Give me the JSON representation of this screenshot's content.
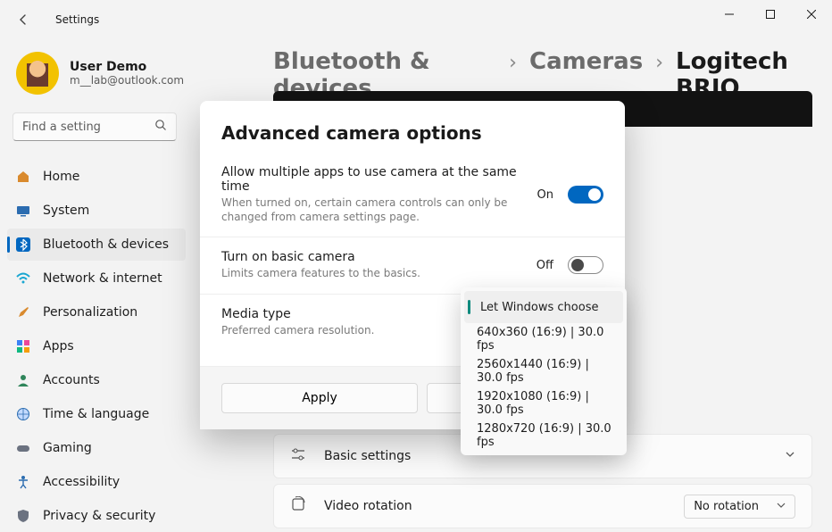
{
  "window": {
    "title": "Settings"
  },
  "user": {
    "name": "User Demo",
    "email": "m__lab@outlook.com"
  },
  "search": {
    "placeholder": "Find a setting"
  },
  "sidebar": {
    "items": [
      {
        "label": "Home"
      },
      {
        "label": "System"
      },
      {
        "label": "Bluetooth & devices"
      },
      {
        "label": "Network & internet"
      },
      {
        "label": "Personalization"
      },
      {
        "label": "Apps"
      },
      {
        "label": "Accounts"
      },
      {
        "label": "Time & language"
      },
      {
        "label": "Gaming"
      },
      {
        "label": "Accessibility"
      },
      {
        "label": "Privacy & security"
      }
    ]
  },
  "breadcrumb": {
    "a": "Bluetooth & devices",
    "b": "Cameras",
    "c": "Logitech BRIO"
  },
  "dialog": {
    "title": "Advanced camera options",
    "multi": {
      "title": "Allow multiple apps to use camera at the same time",
      "desc": "When turned on, certain camera controls can only be changed from camera settings page.",
      "state": "On"
    },
    "basic": {
      "title": "Turn on basic camera",
      "desc": "Limits camera features to the basics.",
      "state": "Off"
    },
    "media": {
      "title": "Media type",
      "desc": "Preferred camera resolution."
    },
    "apply": "Apply"
  },
  "dropdown": {
    "options": [
      "Let Windows choose",
      "640x360 (16:9) | 30.0 fps",
      "2560x1440 (16:9) | 30.0 fps",
      "1920x1080 (16:9) | 30.0 fps",
      "1280x720 (16:9) | 30.0 fps"
    ]
  },
  "cards": {
    "basic": "Basic settings",
    "rotation": {
      "label": "Video rotation",
      "value": "No rotation"
    }
  }
}
